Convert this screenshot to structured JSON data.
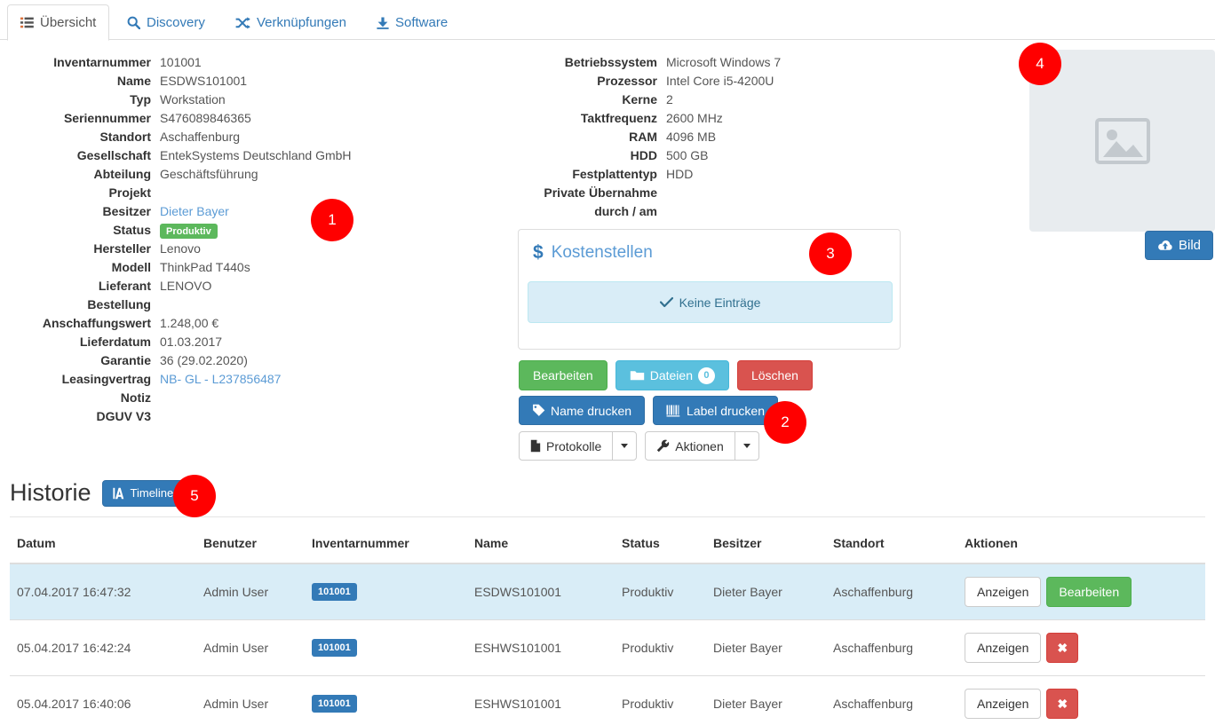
{
  "tabs": [
    {
      "label": "Übersicht",
      "icon": "list-icon",
      "active": true
    },
    {
      "label": "Discovery",
      "icon": "search-icon",
      "active": false
    },
    {
      "label": "Verknüpfungen",
      "icon": "shuffle-icon",
      "active": false
    },
    {
      "label": "Software",
      "icon": "download-icon",
      "active": false
    }
  ],
  "asset_details": [
    {
      "label": "Inventarnummer",
      "value": "101001",
      "style": "plain"
    },
    {
      "label": "Name",
      "value": "ESDWS101001",
      "style": "plain"
    },
    {
      "label": "Typ",
      "value": "Workstation",
      "style": "plain"
    },
    {
      "label": "Seriennummer",
      "value": "S476089846365",
      "style": "plain"
    },
    {
      "label": "Standort",
      "value": "Aschaffenburg",
      "style": "plain"
    },
    {
      "label": "Gesellschaft",
      "value": "EntekSystems Deutschland GmbH",
      "style": "plain"
    },
    {
      "label": "Abteilung",
      "value": "Geschäftsführung",
      "style": "plain"
    },
    {
      "label": "Projekt",
      "value": "",
      "style": "plain"
    },
    {
      "label": "Besitzer",
      "value": "Dieter Bayer",
      "style": "link"
    },
    {
      "label": "Status",
      "value": "Produktiv",
      "style": "badge"
    },
    {
      "label": "Hersteller",
      "value": "Lenovo",
      "style": "plain"
    },
    {
      "label": "Modell",
      "value": "ThinkPad T440s",
      "style": "plain"
    },
    {
      "label": "Lieferant",
      "value": "LENOVO",
      "style": "plain"
    },
    {
      "label": "Bestellung",
      "value": "",
      "style": "plain"
    },
    {
      "label": "Anschaffungswert",
      "value": "1.248,00 €",
      "style": "plain"
    },
    {
      "label": "Lieferdatum",
      "value": "01.03.2017",
      "style": "plain"
    },
    {
      "label": "Garantie",
      "value": "36 (29.02.2020)",
      "style": "plain"
    },
    {
      "label": "Leasingvertrag",
      "value": "NB- GL - L237856487",
      "style": "link"
    },
    {
      "label": "Notiz",
      "value": "",
      "style": "plain"
    },
    {
      "label": "DGUV V3",
      "value": "",
      "style": "plain"
    }
  ],
  "hardware_details": [
    {
      "label": "Betriebssystem",
      "value": "Microsoft Windows 7"
    },
    {
      "label": "Prozessor",
      "value": "Intel Core i5-4200U"
    },
    {
      "label": "Kerne",
      "value": "2"
    },
    {
      "label": "Taktfrequenz",
      "value": "2600 MHz"
    },
    {
      "label": "RAM",
      "value": "4096 MB"
    },
    {
      "label": "HDD",
      "value": "500 GB"
    },
    {
      "label": "Festplattentyp",
      "value": "HDD"
    },
    {
      "label": "Private Übernahme",
      "value": ""
    },
    {
      "label": "durch / am",
      "value": ""
    }
  ],
  "cost_panel": {
    "title": "Kostenstellen",
    "icon": "dollar-icon",
    "empty_message": "Keine Einträge",
    "empty_icon": "check-icon"
  },
  "action_buttons": {
    "row1": [
      {
        "label": "Bearbeiten",
        "style": "green",
        "icon": null
      },
      {
        "label": "Dateien",
        "style": "info",
        "icon": "folder-icon",
        "count": "0"
      },
      {
        "label": "Löschen",
        "style": "danger",
        "icon": null
      }
    ],
    "row2": [
      {
        "label": "Name drucken",
        "style": "primary",
        "icon": "tag-icon"
      },
      {
        "label": "Label drucken",
        "style": "primary",
        "icon": "barcode-icon"
      }
    ],
    "row3": [
      {
        "label": "Protokolle",
        "style": "default",
        "icon": "file-icon",
        "has_dropdown": true
      },
      {
        "label": "Aktionen",
        "style": "default",
        "icon": "wrench-icon",
        "has_dropdown": true
      }
    ]
  },
  "image_panel": {
    "placeholder_icon": "image-placeholder-icon",
    "upload_label": "Bild",
    "upload_icon": "cloud-upload-icon"
  },
  "history": {
    "title": "Historie",
    "timeline_label": "Timeline",
    "timeline_icon": "timeline-icon",
    "columns": [
      "Datum",
      "Benutzer",
      "Inventarnummer",
      "Name",
      "Status",
      "Besitzer",
      "Standort",
      "Aktionen"
    ],
    "rows": [
      {
        "datum": "07.04.2017 16:47:32",
        "benutzer": "Admin User",
        "inventarnummer": "101001",
        "name": "ESDWS101001",
        "status": "Produktiv",
        "besitzer": "Dieter Bayer",
        "standort": "Aschaffenburg",
        "highlight": true,
        "actions": [
          {
            "label": "Anzeigen",
            "style": "default"
          },
          {
            "label": "Bearbeiten",
            "style": "green"
          }
        ]
      },
      {
        "datum": "05.04.2017 16:42:24",
        "benutzer": "Admin User",
        "inventarnummer": "101001",
        "name": "ESHWS101001",
        "status": "Produktiv",
        "besitzer": "Dieter Bayer",
        "standort": "Aschaffenburg",
        "highlight": false,
        "actions": [
          {
            "label": "Anzeigen",
            "style": "default"
          },
          {
            "label": "✖",
            "style": "danger",
            "icon_only": true
          }
        ]
      },
      {
        "datum": "05.04.2017 16:40:06",
        "benutzer": "Admin User",
        "inventarnummer": "101001",
        "name": "ESHWS101001",
        "status": "Produktiv",
        "besitzer": "Dieter Bayer",
        "standort": "Aschaffenburg",
        "highlight": false,
        "actions": [
          {
            "label": "Anzeigen",
            "style": "default"
          },
          {
            "label": "✖",
            "style": "danger",
            "icon_only": true
          }
        ]
      }
    ]
  },
  "annotation_markers": [
    {
      "number": "1"
    },
    {
      "number": "2"
    },
    {
      "number": "3"
    },
    {
      "number": "4"
    },
    {
      "number": "5"
    }
  ],
  "colors": {
    "accent_blue": "#337ab7",
    "link_blue": "#5b9bd5",
    "success_green": "#5cb85c",
    "danger_red": "#d9534f",
    "info_cyan": "#5bc0de",
    "marker_red": "#ff0000",
    "highlight_row": "#d9edf7"
  }
}
